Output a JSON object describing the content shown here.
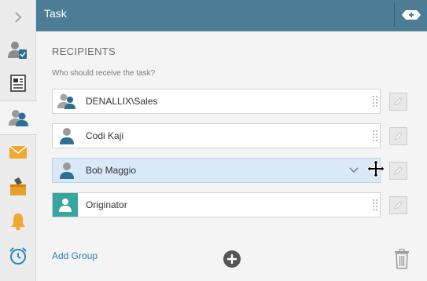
{
  "header": {
    "title": "Task"
  },
  "sidebar": {
    "items": [
      {
        "icon": "chevron-right-icon"
      },
      {
        "icon": "user-task-icon"
      },
      {
        "icon": "document-icon"
      },
      {
        "icon": "users-icon"
      },
      {
        "icon": "envelope-icon"
      },
      {
        "icon": "inbox-icon"
      },
      {
        "icon": "bell-icon"
      },
      {
        "icon": "alarm-clock-icon"
      }
    ]
  },
  "recipients": {
    "title": "RECIPIENTS",
    "subtitle": "Who should receive the task?",
    "items": [
      {
        "label": "DENALLIX\\Sales",
        "icon": "group-icon"
      },
      {
        "label": "Codi Kaji",
        "icon": "user-icon"
      },
      {
        "label": "Bob Maggio",
        "icon": "user-icon",
        "selected": true
      },
      {
        "label": "Originator",
        "icon": "originator-icon"
      }
    ]
  },
  "footer": {
    "add_group_label": "Add Group"
  },
  "colors": {
    "header": "#4d7d95",
    "accent": "#2a7cc0",
    "selected_row": "#d9e9f7",
    "originator": "#36a59d"
  }
}
